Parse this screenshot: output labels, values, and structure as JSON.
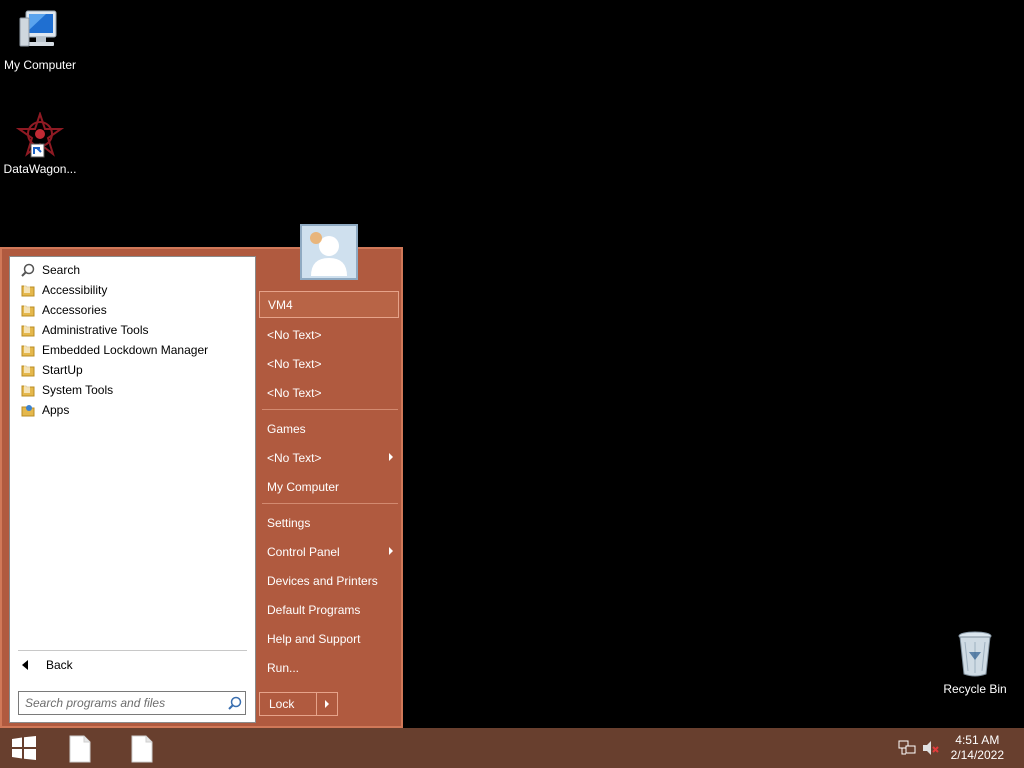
{
  "desktop": {
    "icons": [
      {
        "label": "My Computer",
        "icon": "computer-icon"
      },
      {
        "label": "DataWagon...",
        "icon": "datawagon-icon"
      },
      {
        "label": "Recycle Bin",
        "icon": "recycle-bin-icon"
      }
    ]
  },
  "start_menu": {
    "programs": [
      {
        "label": "Search",
        "icon": "search-icon"
      },
      {
        "label": "Accessibility",
        "icon": "folder-icon"
      },
      {
        "label": "Accessories",
        "icon": "folder-icon"
      },
      {
        "label": "Administrative Tools",
        "icon": "folder-icon"
      },
      {
        "label": "Embedded Lockdown Manager",
        "icon": "folder-icon"
      },
      {
        "label": "StartUp",
        "icon": "folder-icon"
      },
      {
        "label": "System Tools",
        "icon": "folder-icon"
      },
      {
        "label": "Apps",
        "icon": "apps-icon"
      }
    ],
    "back_label": "Back",
    "search": {
      "placeholder": "Search programs and files"
    },
    "right_items": [
      {
        "label": "VM4",
        "selected": true
      },
      {
        "label": "<No Text>"
      },
      {
        "label": "<No Text>"
      },
      {
        "label": "<No Text>"
      },
      {
        "label": "Games"
      },
      {
        "label": "<No Text>",
        "submenu": true
      },
      {
        "label": "My Computer"
      },
      {
        "label": "Settings"
      },
      {
        "label": "Control Panel",
        "submenu": true
      },
      {
        "label": "Devices and Printers"
      },
      {
        "label": "Default Programs"
      },
      {
        "label": "Help and Support"
      },
      {
        "label": "Run..."
      }
    ],
    "lock_label": "Lock"
  },
  "taskbar": {
    "clock_time": "4:51 AM",
    "clock_date": "2/14/2022"
  },
  "colors": {
    "start_menu_bg": "#b05a3f",
    "taskbar_bg": "#683f2e",
    "desktop_bg": "#000000"
  }
}
